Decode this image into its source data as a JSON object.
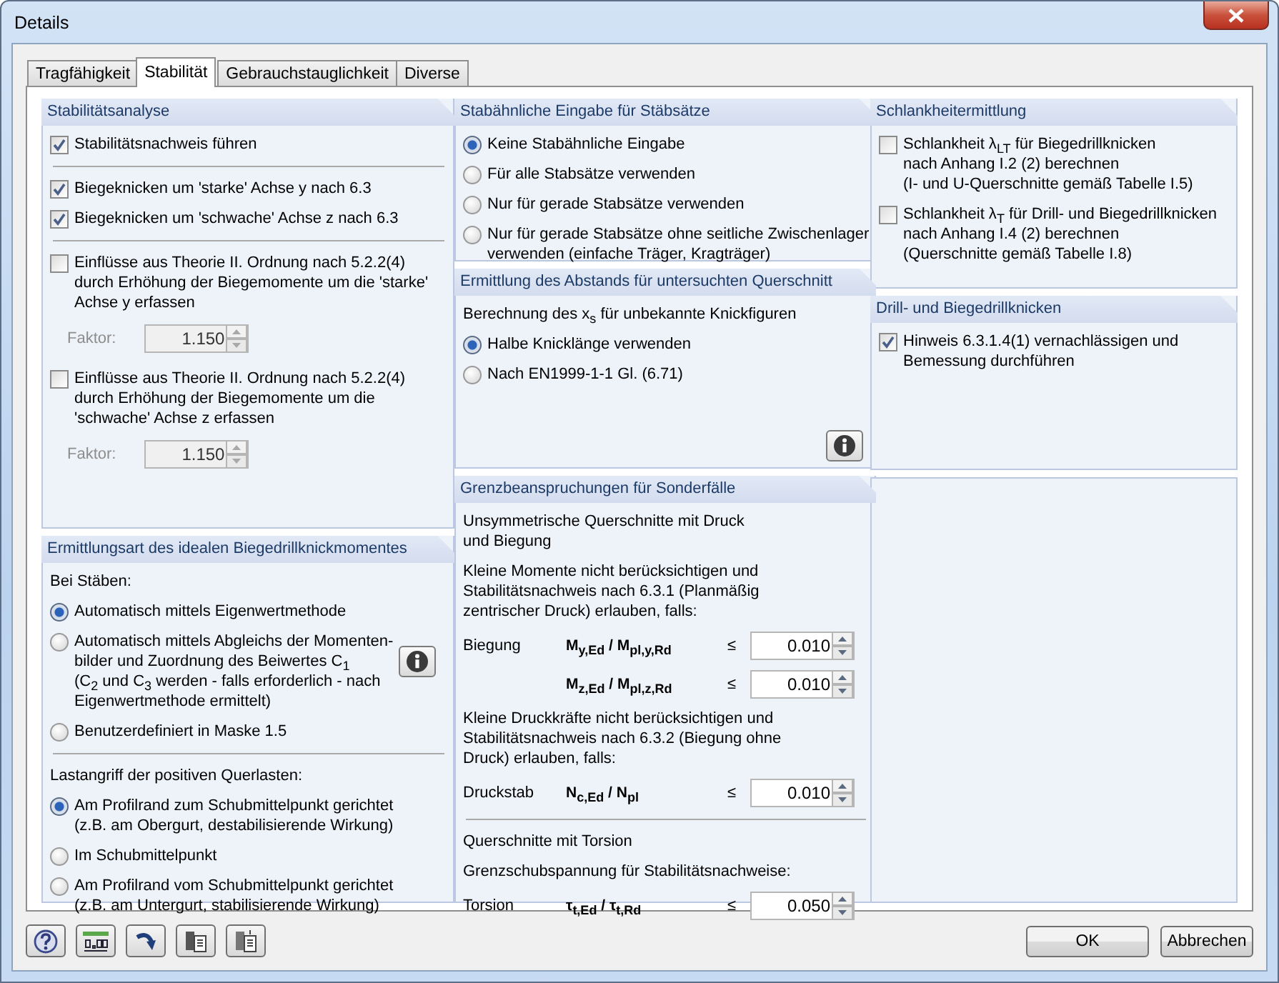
{
  "window": {
    "title": "Details"
  },
  "tabs": [
    {
      "label": "Tragfähigkeit",
      "selected": false
    },
    {
      "label": "Stabilität",
      "selected": true
    },
    {
      "label": "Gebrauchstauglichkeit",
      "selected": false
    },
    {
      "label": "Diverse",
      "selected": false
    }
  ],
  "columns": [
    [
      {
        "kind": "group",
        "title": "Stabilitätsanalyse",
        "sections": [
          {
            "items": [
              {
                "kind": "checkbox",
                "label": "Stabilitätsnachweis führen",
                "checked": true
              }
            ]
          },
          {
            "items": [
              {
                "kind": "checkbox",
                "label": "Biegeknicken um 'starke' Achse y nach 6.3",
                "checked": true
              },
              {
                "kind": "checkbox",
                "label": "Biegeknicken um 'schwache' Achse z nach 6.3",
                "checked": true
              }
            ]
          },
          {
            "items": [
              {
                "kind": "checkbox",
                "label": "Einflüsse aus Theorie II. Ordnung nach 5.2.2(4)\ndurch Erhöhung der Biegemomente um die 'starke'\nAchse y erfassen",
                "checked": false
              },
              {
                "kind": "factor",
                "label": "Faktor:",
                "value": "1.150",
                "disabled": true
              },
              {
                "kind": "checkbox",
                "label": "Einflüsse aus Theorie II. Ordnung nach 5.2.2(4)\ndurch Erhöhung der Biegemomente um die\n'schwache' Achse z erfassen",
                "checked": false
              },
              {
                "kind": "factor",
                "label": "Faktor:",
                "value": "1.150",
                "disabled": true
              }
            ]
          }
        ]
      },
      {
        "kind": "group",
        "title": "Ermittlungsart des idealen Biegedrillknickmomentes",
        "sections": [
          {
            "items": [
              {
                "kind": "text",
                "text": "Bei Stäben:"
              },
              {
                "kind": "radio",
                "label": "Automatisch mittels Eigenwertmethode",
                "selected": true
              },
              {
                "kind": "radio",
                "label": "Automatisch mittels Abgleichs der Momenten-\nbilder und Zuordnung des Beiwertes C$_{1}$\n(C$_{2}$ und C$_{3}$ werden - falls erforderlich - nach\nEigenwertmethode ermittelt)",
                "selected": false,
                "info_button": true
              },
              {
                "kind": "radio",
                "label": "Benutzerdefiniert in Maske 1.5",
                "selected": false
              }
            ]
          },
          {
            "items": [
              {
                "kind": "text",
                "text": "Lastangriff der positiven Querlasten:"
              },
              {
                "kind": "radio",
                "label": "Am Profilrand zum Schubmittelpunkt gerichtet\n(z.B. am Obergurt, destabilisierende Wirkung)",
                "selected": true
              },
              {
                "kind": "radio",
                "label": "Im Schubmittelpunkt",
                "selected": false
              },
              {
                "kind": "radio",
                "label": "Am Profilrand vom Schubmittelpunkt gerichtet\n(z.B. am Untergurt, stabilisierende Wirkung)",
                "selected": false
              }
            ]
          }
        ]
      }
    ],
    [
      {
        "kind": "group",
        "title": "Stabähnliche Eingabe für Stäbsätze",
        "sections": [
          {
            "items": [
              {
                "kind": "radio",
                "label": "Keine Stabähnliche Eingabe",
                "selected": true
              },
              {
                "kind": "radio",
                "label": "Für alle Stabsätze verwenden",
                "selected": false
              },
              {
                "kind": "radio",
                "label": "Nur für gerade Stabsätze verwenden",
                "selected": false
              },
              {
                "kind": "radio",
                "label": "Nur für gerade Stabsätze ohne seitliche Zwischenlager\nverwenden (einfache Träger, Kragträger)",
                "selected": false
              }
            ]
          }
        ]
      },
      {
        "kind": "group",
        "title": "Ermittlung des Abstands für untersuchten Querschnitt",
        "sections": [
          {
            "items": [
              {
                "kind": "text",
                "text": "Berechnung des x$_{s}$ für unbekannte Knickfiguren"
              },
              {
                "kind": "radio",
                "label": "Halbe Knicklänge verwenden",
                "selected": true
              },
              {
                "kind": "radio",
                "label": "Nach EN1999-1-1 Gl. (6.71)",
                "selected": false
              },
              {
                "kind": "info"
              }
            ]
          }
        ]
      },
      {
        "kind": "group",
        "title": "Grenzbeanspruchungen für Sonderfälle",
        "sections": [
          {
            "items": [
              {
                "kind": "text",
                "text": "Unsymmetrische Querschnitte mit Druck\nund Biegung"
              },
              {
                "kind": "text",
                "text": "Kleine Momente nicht berücksichtigen und\nStabilitätsnachweis nach 6.3.1 (Planmäßig\nzentrischer Druck) erlauben, falls:"
              },
              {
                "kind": "limit",
                "label": "Biegung",
                "formula": "M$_{y,Ed}$ / M$_{pl,y,Rd}$",
                "sign": "≤",
                "value": "0.010"
              },
              {
                "kind": "limit",
                "formula": "M$_{z,Ed}$ / M$_{pl,z,Rd}$",
                "sign": "≤",
                "value": "0.010"
              },
              {
                "kind": "text",
                "text": "Kleine Druckkräfte nicht berücksichtigen und\nStabilitätsnachweis nach 6.3.2 (Biegung ohne\nDruck) erlauben, falls:"
              },
              {
                "kind": "limit",
                "label": "Druckstab",
                "formula": "N$_{c,Ed}$ / N$_{pl}$",
                "sign": "≤",
                "value": "0.010"
              }
            ]
          },
          {
            "items": [
              {
                "kind": "text",
                "text": "Querschnitte mit Torsion"
              },
              {
                "kind": "text",
                "text": "Grenzschubspannung für Stabilitätsnachweise:"
              },
              {
                "kind": "limit",
                "label": "Torsion",
                "formula": "τ$_{t,Ed}$ / τ$_{t,Rd}$",
                "sign": "≤",
                "value": "0.050"
              }
            ]
          }
        ]
      }
    ],
    [
      {
        "kind": "group",
        "title": "Schlankheitermittlung",
        "sections": [
          {
            "items": [
              {
                "kind": "checkbox",
                "label": "Schlankheit λ$_{LT}$ für Biegedrillknicken\nnach Anhang I.2 (2) berechnen\n(I- und U-Querschnitte gemäß Tabelle I.5)",
                "checked": false
              },
              {
                "kind": "checkbox",
                "label": "Schlankheit λ$_{T}$ für Drill- und Biegedrillknicken\nnach Anhang I.4 (2) berechnen\n(Querschnitte gemäß Tabelle I.8)",
                "checked": false
              }
            ]
          }
        ]
      },
      {
        "kind": "group",
        "title": "Drill- und Biegedrillknicken",
        "sections": [
          {
            "items": [
              {
                "kind": "checkbox",
                "label": "Hinweis 6.3.1.4(1) vernachlässigen und\nBemessung durchführen",
                "checked": true
              }
            ]
          }
        ]
      },
      {
        "kind": "blank"
      }
    ]
  ],
  "buttons": [
    {
      "label": "OK"
    },
    {
      "label": "Abbrechen"
    }
  ]
}
